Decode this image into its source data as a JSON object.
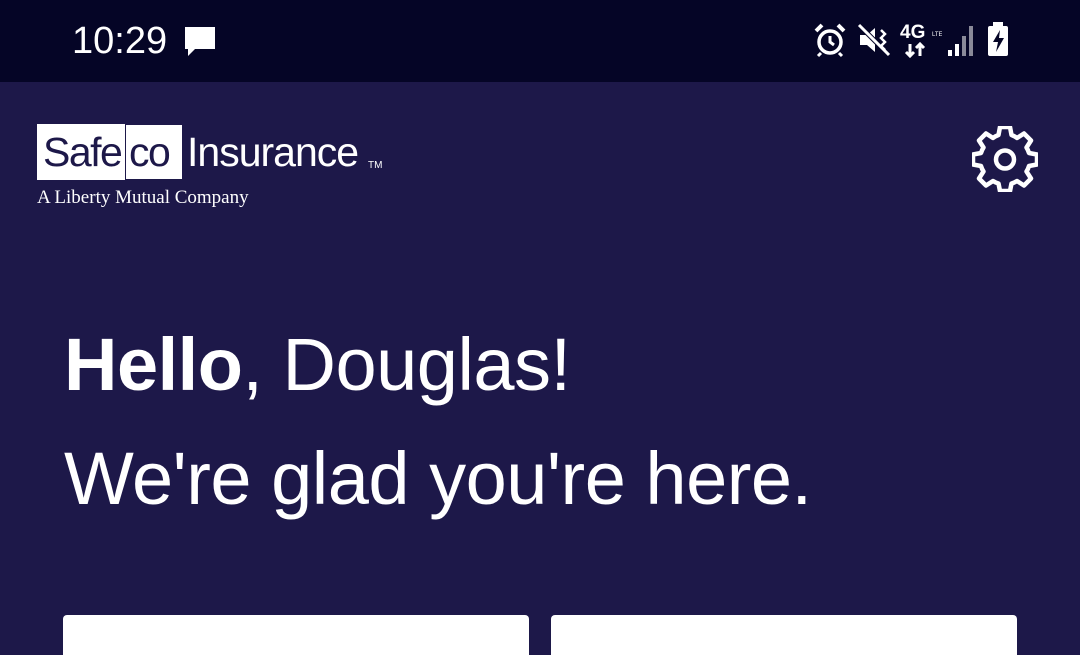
{
  "status_bar": {
    "time": "10:29",
    "icons": [
      "message-icon",
      "alarm-icon",
      "vibrate-icon",
      "4g-lte-icon",
      "signal-icon",
      "battery-charging-icon"
    ],
    "network_label": "4G"
  },
  "header": {
    "logo": {
      "safe": "Safe",
      "co": "co",
      "insurance": "Insurance",
      "tm": "TM",
      "tagline": "A Liberty Mutual Company"
    },
    "settings_icon": "gear-icon"
  },
  "greeting": {
    "hello": "Hello",
    "name_part": ", Douglas!",
    "subtitle": "We're glad you're here."
  },
  "colors": {
    "background": "#1d1849",
    "status_bar": "#050526",
    "text": "#ffffff"
  }
}
